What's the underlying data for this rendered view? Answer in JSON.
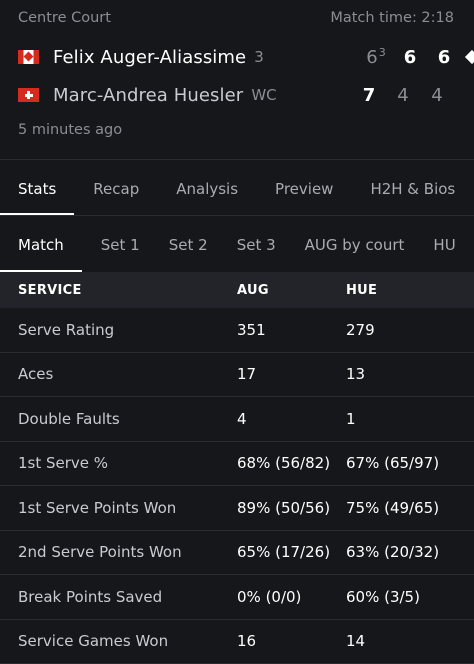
{
  "match": {
    "court": "Centre Court",
    "match_time": "Match time: 2:18",
    "updated": "5 minutes ago",
    "players": [
      {
        "name": "Felix Auger-Aliassime",
        "seed": "3",
        "flag": "canada-flag-icon",
        "scores": [
          "6",
          "6",
          "6"
        ],
        "tiebreak": "3",
        "serving": true
      },
      {
        "name": "Marc-Andrea Huesler",
        "seed": "WC",
        "flag": "switzerland-flag-icon",
        "scores": [
          "7",
          "4",
          "4"
        ]
      }
    ]
  },
  "tabs": [
    "Stats",
    "Recap",
    "Analysis",
    "Preview",
    "H2H & Bios"
  ],
  "subtabs": [
    "Match",
    "Set 1",
    "Set 2",
    "Set 3",
    "AUG by court",
    "HU"
  ],
  "stats": {
    "section": "SERVICE",
    "col_aug": "AUG",
    "col_hue": "HUE",
    "rows": [
      {
        "label": "Serve Rating",
        "aug": "351",
        "hue": "279"
      },
      {
        "label": "Aces",
        "aug": "17",
        "hue": "13"
      },
      {
        "label": "Double Faults",
        "aug": "4",
        "hue": "1"
      },
      {
        "label": "1st Serve %",
        "aug": "68% (56/82)",
        "hue": "67% (65/97)"
      },
      {
        "label": "1st Serve Points Won",
        "aug": "89% (50/56)",
        "hue": "75% (49/65)"
      },
      {
        "label": "2nd Serve Points Won",
        "aug": "65% (17/26)",
        "hue": "63% (20/32)"
      },
      {
        "label": "Break Points Saved",
        "aug": "0% (0/0)",
        "hue": "60% (3/5)"
      },
      {
        "label": "Service Games Won",
        "aug": "16",
        "hue": "14"
      }
    ]
  }
}
